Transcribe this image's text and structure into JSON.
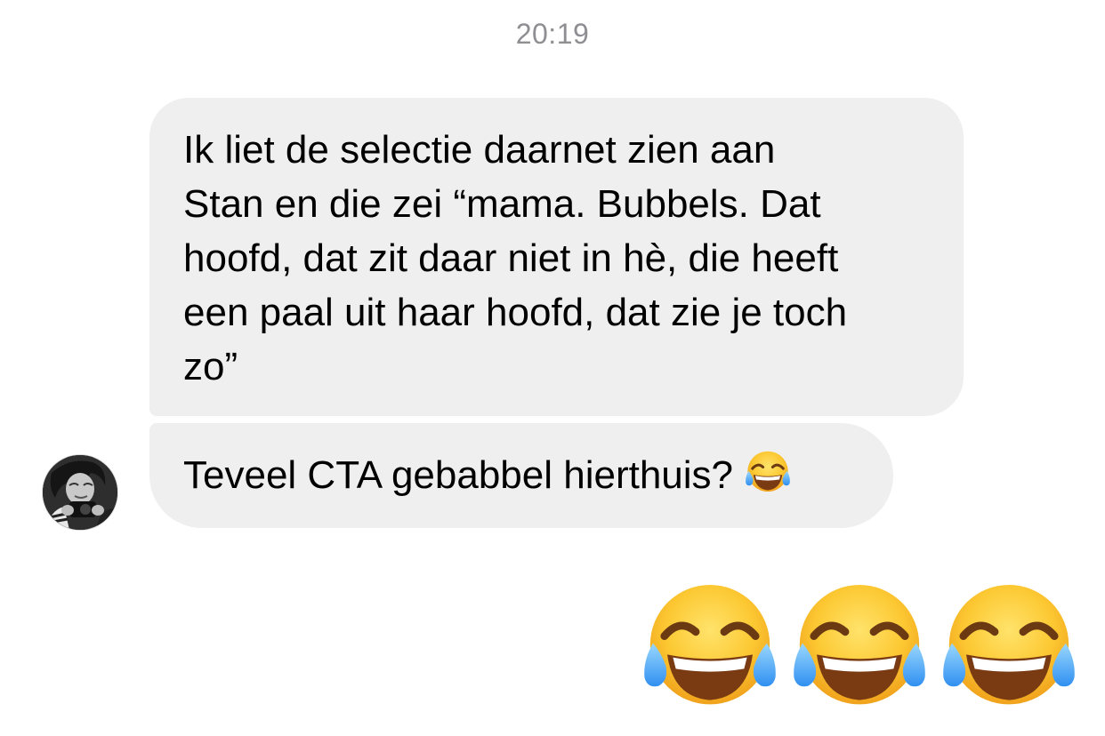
{
  "conversation": {
    "timestamp": "20:19",
    "messages": [
      {
        "text": "Ik liet de selectie daarnet zien aan\nStan en die zei “mama. Bubbels. Dat\nhoofd, dat zit daar niet in hè, die heeft\neen paal uit haar hoofd, dat zie je toch\nzo”"
      },
      {
        "text": "Teveel CTA gebabbel hierthuis?",
        "emoji": "face-with-tears-of-joy"
      }
    ],
    "reply": {
      "emojis": [
        "face-with-tears-of-joy",
        "face-with-tears-of-joy",
        "face-with-tears-of-joy"
      ]
    }
  },
  "colors": {
    "bubble_background": "#efefef",
    "timestamp_text": "#8e8e93",
    "emoji_face": "#f9c22e",
    "emoji_tears": "#5db8ff"
  }
}
